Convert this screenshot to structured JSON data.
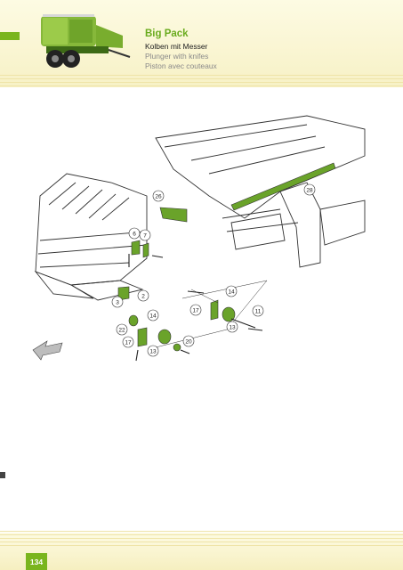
{
  "header": {
    "title": "Big Pack",
    "subtitle_de": "Kolben mit Messer",
    "subtitle_en": "Plunger with knifes",
    "subtitle_fr": "Piston avec couteaux"
  },
  "diagram": {
    "callouts": [
      "26",
      "28",
      "6",
      "7",
      "2",
      "3",
      "14",
      "17",
      "11",
      "13",
      "22",
      "14",
      "17",
      "13",
      "20"
    ]
  },
  "footer": {
    "page_number": "134"
  },
  "colors": {
    "accent_green": "#7ab51d",
    "band_cream": "#f7f1c6"
  }
}
